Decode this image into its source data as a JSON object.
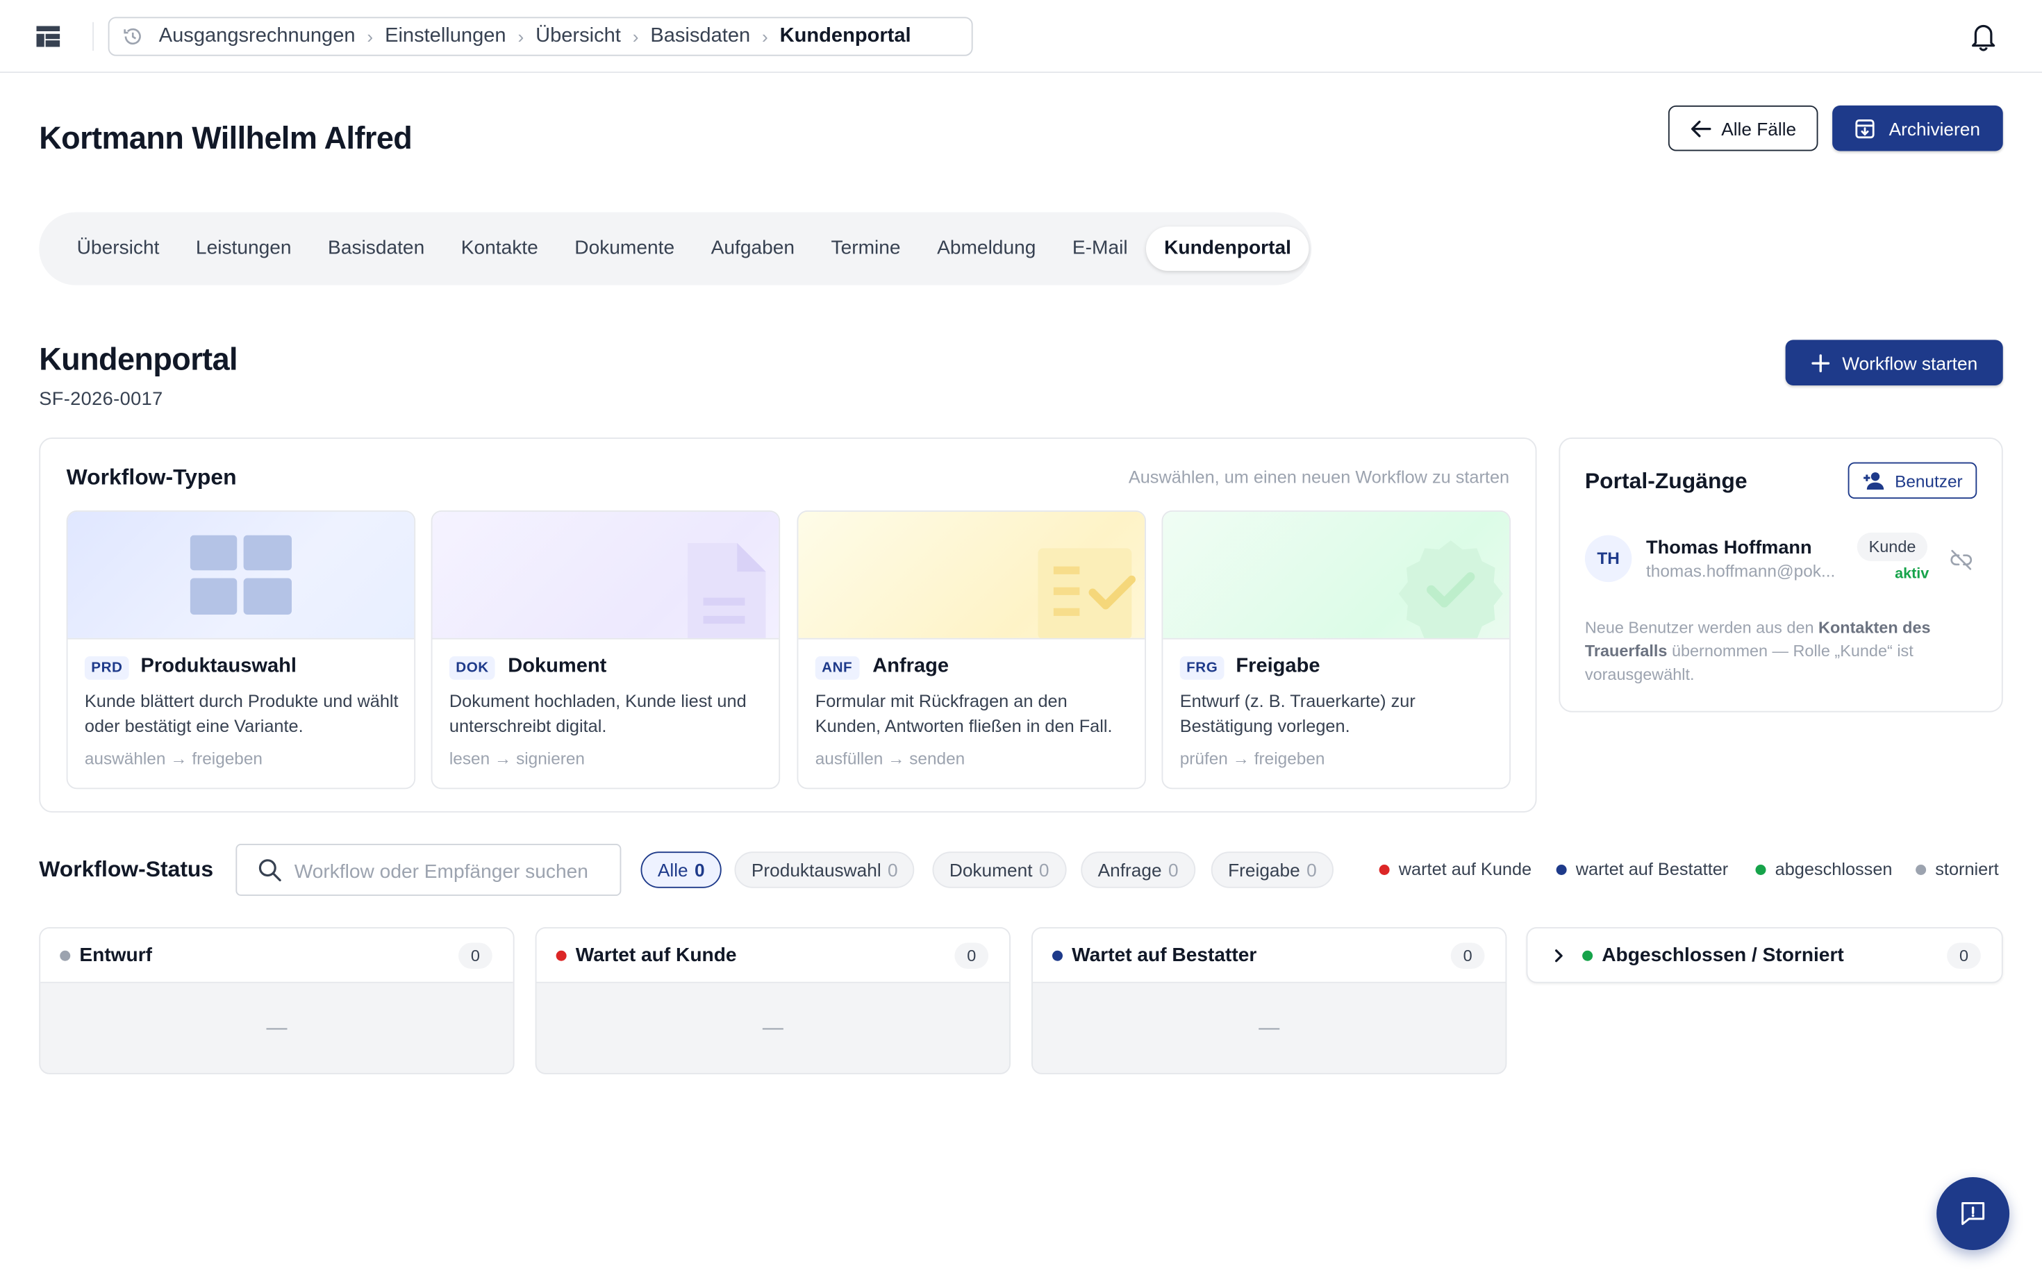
{
  "breadcrumb": {
    "items": [
      "Ausgangsrechnungen",
      "Einstellungen",
      "Übersicht",
      "Basisdaten"
    ],
    "current": "Kundenportal"
  },
  "header": {
    "title": "Kortmann Willhelm Alfred",
    "all_cases_label": "Alle Fälle",
    "archive_label": "Archivieren"
  },
  "tabs": [
    {
      "label": "Übersicht",
      "active": false
    },
    {
      "label": "Leistungen",
      "active": false
    },
    {
      "label": "Basisdaten",
      "active": false
    },
    {
      "label": "Kontakte",
      "active": false
    },
    {
      "label": "Dokumente",
      "active": false
    },
    {
      "label": "Aufgaben",
      "active": false
    },
    {
      "label": "Termine",
      "active": false
    },
    {
      "label": "Abmeldung",
      "active": false
    },
    {
      "label": "E-Mail",
      "active": false
    },
    {
      "label": "Kundenportal",
      "active": true
    }
  ],
  "section": {
    "title": "Kundenportal",
    "id": "SF-2026-0017",
    "start_label": "Workflow starten"
  },
  "workflow_types": {
    "title": "Workflow-Typen",
    "hint": "Auswählen, um einen neuen Workflow zu starten",
    "items": [
      {
        "code": "PRD",
        "name": "Produktauswahl",
        "desc": "Kunde blättert durch Produkte und wählt oder bestätigt eine Variante.",
        "flow": "auswählen → freigeben",
        "icon": "grid-icon"
      },
      {
        "code": "DOK",
        "name": "Dokument",
        "desc": "Dokument hochladen, Kunde liest und unterschreibt digital.",
        "flow": "lesen → signieren",
        "icon": "document-icon"
      },
      {
        "code": "ANF",
        "name": "Anfrage",
        "desc": "Formular mit Rückfragen an den Kunden, Antworten fließen in den Fall.",
        "flow": "ausfüllen → senden",
        "icon": "form-check-icon"
      },
      {
        "code": "FRG",
        "name": "Freigabe",
        "desc": "Entwurf (z. B. Trauerkarte) zur Bestätigung vorlegen.",
        "flow": "prüfen → freigeben",
        "icon": "verified-badge-icon"
      }
    ]
  },
  "portal": {
    "title": "Portal-Zugänge",
    "user_button": "Benutzer",
    "user": {
      "initials": "TH",
      "name": "Thomas Hoffmann",
      "email": "thomas.hoffmann@pok...",
      "role": "Kunde",
      "status": "aktiv"
    },
    "note_pre": "Neue Benutzer werden aus den ",
    "note_bold": "Kontakten des Trauerfalls",
    "note_post": " übernommen — Rolle „Kunde“ ist vorausgewählt."
  },
  "status": {
    "title": "Workflow-Status",
    "search_placeholder": "Workflow oder Empfänger suchen",
    "filters": [
      {
        "label": "Alle",
        "count": "0",
        "active": true
      },
      {
        "label": "Produktauswahl",
        "count": "0",
        "active": false
      },
      {
        "label": "Dokument",
        "count": "0",
        "active": false
      },
      {
        "label": "Anfrage",
        "count": "0",
        "active": false
      },
      {
        "label": "Freigabe",
        "count": "0",
        "active": false
      }
    ],
    "legend": [
      {
        "label": "wartet auf Kunde",
        "color": "#dc2626"
      },
      {
        "label": "wartet auf Bestatter",
        "color": "#1e3a8a"
      },
      {
        "label": "abgeschlossen",
        "color": "#16a34a"
      },
      {
        "label": "storniert",
        "color": "#9ca3af"
      }
    ],
    "columns": [
      {
        "label": "Entwurf",
        "count": "0",
        "color": "#9ca3af",
        "empty": "—"
      },
      {
        "label": "Wartet auf Kunde",
        "count": "0",
        "color": "#dc2626",
        "empty": "—"
      },
      {
        "label": "Wartet auf Bestatter",
        "count": "0",
        "color": "#1e3a8a",
        "empty": "—"
      }
    ],
    "closed": {
      "label": "Abgeschlossen / Storniert",
      "count": "0",
      "color": "#16a34a"
    }
  },
  "colors": {
    "primary": "#1e3a8a",
    "success": "#16a34a",
    "danger": "#dc2626"
  }
}
